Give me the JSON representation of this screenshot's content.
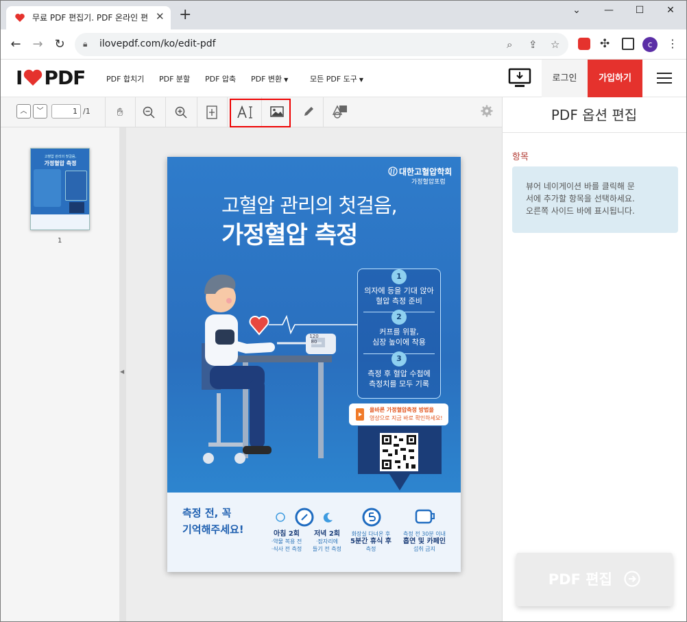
{
  "browser": {
    "tab_title": "무료 PDF 편집기. PDF 온라인 편",
    "url": "ilovepdf.com/ko/edit-pdf",
    "profile_initial": "c"
  },
  "site": {
    "logo_left": "I",
    "logo_right": "PDF",
    "nav": [
      "PDF 합치기",
      "PDF 분할",
      "PDF 압축",
      "PDF 변환",
      "모든 PDF 도구"
    ],
    "login": "로그인",
    "signup": "가입하기"
  },
  "editor": {
    "current_page": "1",
    "total_pages": "/1",
    "thumb_label": "1",
    "tools": [
      "hand-icon",
      "zoom-out-icon",
      "zoom-in-icon",
      "fit-icon",
      "text-icon",
      "image-icon",
      "pen-icon",
      "shape-icon",
      "settings-icon"
    ]
  },
  "right_panel": {
    "title": "PDF 옵션 편집",
    "section": "항목",
    "info_lines": [
      "뷰어 네이게이션 바를 클릭해 문",
      "서에 추가할 항목을 선택하세요.",
      "오른쪽 사이드 바에 표시됩니다."
    ],
    "action_button": "PDF 편집"
  },
  "poster": {
    "org_name": "대한고혈압학회",
    "org_sub": "가정혈압포럼",
    "headline1": "고혈압 관리의 첫걸음,",
    "headline2": "가정혈압 측정",
    "steps": [
      {
        "n": "1",
        "line1": "의자에 등을 기대 앉아",
        "line2": "혈압 측정 준비"
      },
      {
        "n": "2",
        "line1": "커프를 위팔,",
        "line2": "심장 높이에 착용"
      },
      {
        "n": "3",
        "line1": "측정 후 혈압 수첩에",
        "line2": "측정치를 모두 기록"
      }
    ],
    "video_line1": "올바른 가정혈압측정 방법을",
    "video_line2": "영상으로 지금 바로 확인하세요!",
    "monitor_reading1": "120",
    "monitor_reading2": "80",
    "footer_left1": "측정 전, 꼭",
    "footer_left2": "기억해주세요!",
    "footer_items": [
      {
        "title": "아침 2회",
        "l1": "·약물 복용 전",
        "l2": "·식사 전 측정"
      },
      {
        "title": "저녁 2회",
        "l1": "·잠자리에",
        "l2": "들기 전 측정"
      },
      {
        "title": "5분간 휴식 후",
        "pre": "화장실 다녀온 후",
        "l1": "측정",
        "l2": ""
      },
      {
        "title": "흡연 및 카페인",
        "pre": "측정 전 30분 이내",
        "l1": "섭취 금지",
        "l2": ""
      }
    ],
    "thumb_title1": "고혈압 관리의 첫걸음,",
    "thumb_title2": "가정혈압 측정"
  },
  "colors": {
    "brand_red": "#e5322d",
    "poster_blue": "#2a6fbe",
    "highlight_red": "#ee0000",
    "info_bg": "#dbebf3"
  }
}
